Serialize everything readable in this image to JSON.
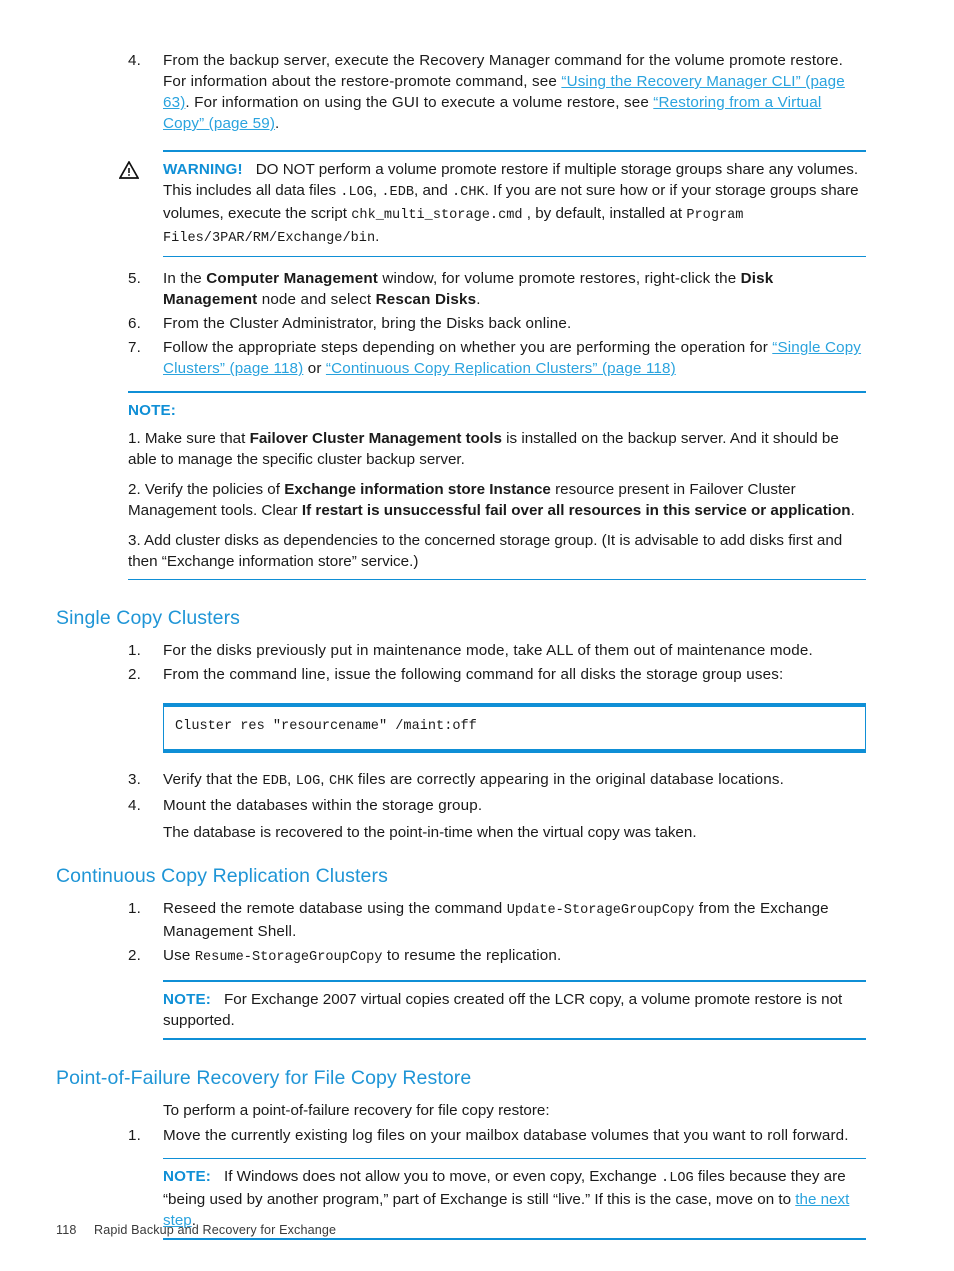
{
  "document": {
    "footer": {
      "page_number": "118",
      "title": "Rapid Backup and Recovery for Exchange"
    },
    "colors": {
      "link": "#2aa3de",
      "heading": "#1f95d6",
      "rule": "#0f8fd6",
      "text": "#1a1a1a"
    }
  },
  "step4": {
    "num": "4.",
    "t1": "From the backup server, execute the Recovery Manager command for the volume promote restore. For information about the restore-promote command, see ",
    "link1": "“Using the Recovery Manager CLI” (page 63)",
    "t2": ". For information on using the GUI to execute a volume restore, see ",
    "link2": "“Restoring from a Virtual Copy” (page 59)",
    "t3": "."
  },
  "warning": {
    "icon": "warning-triangle-icon",
    "label": "WARNING!",
    "t1": "DO NOT perform a volume promote restore if multiple storage groups share any volumes. This includes all data files ",
    "code1": ".LOG",
    "t2": ", ",
    "code2": ".EDB",
    "t3": ", and ",
    "code3": ".CHK",
    "t4": ". If you are not sure how or if your storage groups share volumes, execute the script ",
    "code4": "chk_multi_storage.cmd",
    "t5": " , by default, installed at ",
    "code5": "Program Files/3PAR/RM/Exchange/bin",
    "t6": "."
  },
  "step5": {
    "num": "5.",
    "t1": "In the ",
    "b1": "Computer Management",
    "t2": " window, for volume promote restores, right-click the ",
    "b2": "Disk Management",
    "t3": " node and select ",
    "b3": "Rescan Disks",
    "t4": "."
  },
  "step6": {
    "num": "6.",
    "t1": "From the Cluster Administrator, bring the Disks back online."
  },
  "step7": {
    "num": "7.",
    "t1": "Follow the appropriate steps depending on whether you are performing the operation for ",
    "link1": "“Single Copy Clusters” (page 118)",
    "t2": " or ",
    "link2": "“Continuous Copy Replication Clusters” (page 118)"
  },
  "note1": {
    "label": "NOTE:",
    "item1_a": "1. Make sure that ",
    "item1_b": "Failover Cluster Management tools",
    "item1_c": " is installed on the backup server. And it should be able to manage the specific cluster backup server.",
    "item2_a": "2. Verify the policies of ",
    "item2_b": "Exchange information store Instance",
    "item2_c": " resource present in Failover Cluster Management tools. Clear ",
    "item2_d": "If restart is unsuccessful fail over all resources in this service or application",
    "item2_e": ".",
    "item3": "3. Add cluster disks as dependencies to the concerned storage group. (It is advisable to add disks first and then “Exchange information store” service.)"
  },
  "single_copy_clusters": {
    "heading": "Single Copy Clusters",
    "step1": {
      "num": "1.",
      "t1": "For the disks previously put in maintenance mode, take ALL of them out of maintenance mode."
    },
    "step2": {
      "num": "2.",
      "t1": "From the command line, issue the following command for all disks the storage group uses:"
    },
    "code": "Cluster res \"resourcename\" /maint:off",
    "step3": {
      "num": "3.",
      "t1": "Verify that the ",
      "code1": "EDB",
      "t2": ", ",
      "code2": "LOG",
      "t3": ", ",
      "code3": "CHK",
      "t4": " files are correctly appearing in the original database locations."
    },
    "step4": {
      "num": "4.",
      "t1": "Mount the databases within the storage group."
    },
    "trailer": "The database is recovered to the point-in-time when the virtual copy was taken."
  },
  "ccr_clusters": {
    "heading": "Continuous Copy Replication Clusters",
    "step1": {
      "num": "1.",
      "t1": "Reseed the remote database using the command ",
      "code1": "Update-StorageGroupCopy",
      "t2": " from the Exchange Management Shell."
    },
    "step2": {
      "num": "2.",
      "t1": "Use ",
      "code1": "Resume-StorageGroupCopy",
      "t2": " to resume the replication."
    },
    "note": {
      "label": "NOTE:",
      "t1": "For Exchange 2007 virtual copies created off the LCR copy, a volume promote restore is not supported."
    }
  },
  "point_of_failure": {
    "heading": "Point-of-Failure Recovery for File Copy Restore",
    "intro": "To perform a point-of-failure recovery for file copy restore:",
    "step1": {
      "num": "1.",
      "t1": "Move the currently existing log files on your mailbox database volumes that you want to roll forward."
    },
    "note": {
      "label": "NOTE:",
      "t1": "If Windows does not allow you to move, or even copy, Exchange ",
      "code1": ".LOG",
      "t2": " files because they are “being used by another program,” part of Exchange is still “live.” If this is the case, move on to ",
      "link1": "the next step",
      "t3": "."
    }
  }
}
